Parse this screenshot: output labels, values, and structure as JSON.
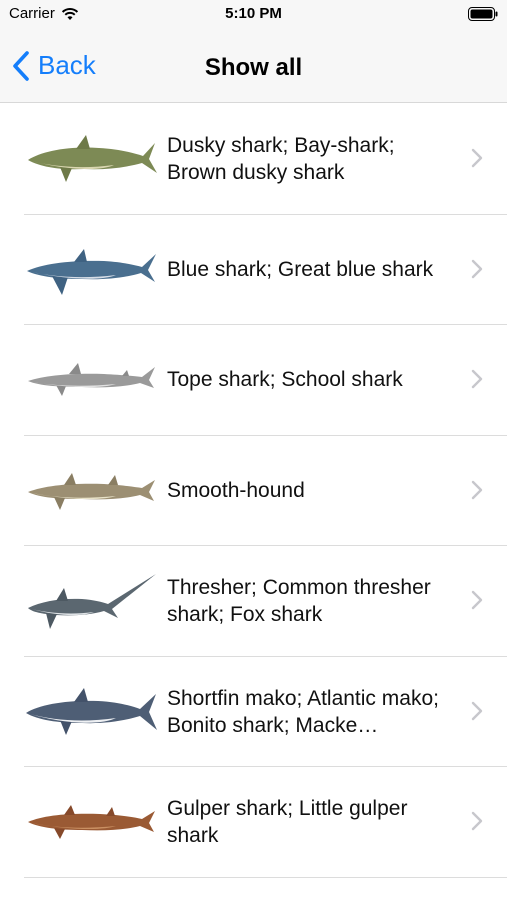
{
  "status": {
    "carrier": "Carrier",
    "time": "5:10 PM"
  },
  "nav": {
    "back_label": "Back",
    "title": "Show all"
  },
  "colors": {
    "accent": "#147efb",
    "chevron": "#c7c7cc",
    "separator": "#dcdcdc"
  },
  "sharks": [
    {
      "name": "Dusky shark; Bay-shark; Brown dusky shark",
      "icon": "dusky-shark-image"
    },
    {
      "name": "Blue shark; Great blue shark",
      "icon": "blue-shark-image"
    },
    {
      "name": "Tope shark; School shark",
      "icon": "tope-shark-image"
    },
    {
      "name": "Smooth-hound",
      "icon": "smooth-hound-image"
    },
    {
      "name": "Thresher; Common thresher shark; Fox shark",
      "icon": "thresher-shark-image"
    },
    {
      "name": "Shortfin mako; Atlantic mako; Bonito shark; Macke…",
      "icon": "shortfin-mako-image"
    },
    {
      "name": "Gulper shark; Little gulper shark",
      "icon": "gulper-shark-image"
    }
  ]
}
